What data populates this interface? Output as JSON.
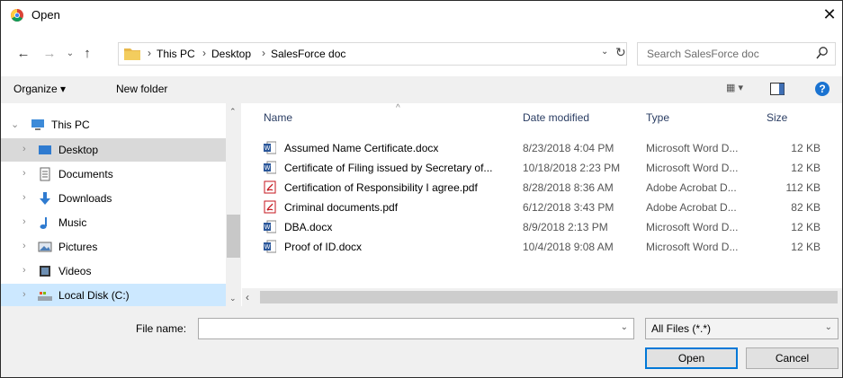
{
  "window": {
    "title": "Open",
    "close_glyph": "✕"
  },
  "nav": {
    "back_glyph": "←",
    "forward_glyph": "→",
    "recent_glyph": "⌄",
    "up_glyph": "↑",
    "breadcrumbs": [
      "This PC",
      "Desktop",
      "SalesForce doc"
    ],
    "separator": "›",
    "dropdown_glyph": "⌄",
    "refresh_glyph": "↻",
    "search_placeholder": "Search SalesForce doc"
  },
  "toolbar": {
    "organize": "Organize ▾",
    "new_folder": "New folder",
    "view_glyph": "▦ ▾",
    "help": "?"
  },
  "tree": {
    "items": [
      {
        "label": "This PC",
        "icon": "pc-icon",
        "arrow": "⌄"
      },
      {
        "label": "Desktop",
        "icon": "desktop-icon",
        "arrow": "›"
      },
      {
        "label": "Documents",
        "icon": "documents-icon",
        "arrow": "›"
      },
      {
        "label": "Downloads",
        "icon": "downloads-icon",
        "arrow": "›"
      },
      {
        "label": "Music",
        "icon": "music-icon",
        "arrow": "›"
      },
      {
        "label": "Pictures",
        "icon": "pictures-icon",
        "arrow": "›"
      },
      {
        "label": "Videos",
        "icon": "videos-icon",
        "arrow": "›"
      },
      {
        "label": "Local Disk (C:)",
        "icon": "disk-icon",
        "arrow": "›"
      }
    ],
    "scroll_up": "⌃",
    "scroll_down": "⌄"
  },
  "list": {
    "columns": {
      "name": "Name",
      "date": "Date modified",
      "type": "Type",
      "size": "Size"
    },
    "sort_caret": "^",
    "files": [
      {
        "name": "Assumed Name Certificate.docx",
        "date": "8/23/2018 4:04 PM",
        "type": "Microsoft Word D...",
        "size": "12 KB",
        "icon": "word"
      },
      {
        "name": "Certificate of Filing issued by Secretary of...",
        "date": "10/18/2018 2:23 PM",
        "type": "Microsoft Word D...",
        "size": "12 KB",
        "icon": "word"
      },
      {
        "name": "Certification of Responsibility I agree.pdf",
        "date": "8/28/2018 8:36 AM",
        "type": "Adobe Acrobat D...",
        "size": "112 KB",
        "icon": "pdf"
      },
      {
        "name": "Criminal documents.pdf",
        "date": "6/12/2018 3:43 PM",
        "type": "Adobe Acrobat D...",
        "size": "82 KB",
        "icon": "pdf"
      },
      {
        "name": "DBA.docx",
        "date": "8/9/2018 2:13 PM",
        "type": "Microsoft Word D...",
        "size": "12 KB",
        "icon": "word"
      },
      {
        "name": "Proof of ID.docx",
        "date": "10/4/2018 9:08 AM",
        "type": "Microsoft Word D...",
        "size": "12 KB",
        "icon": "word"
      }
    ],
    "hscroll_left": "‹"
  },
  "bottom": {
    "file_name_label": "File name:",
    "file_name_value": "",
    "filter": "All Files (*.*)",
    "dropdown_glyph": "⌄",
    "open": "Open",
    "cancel": "Cancel"
  }
}
